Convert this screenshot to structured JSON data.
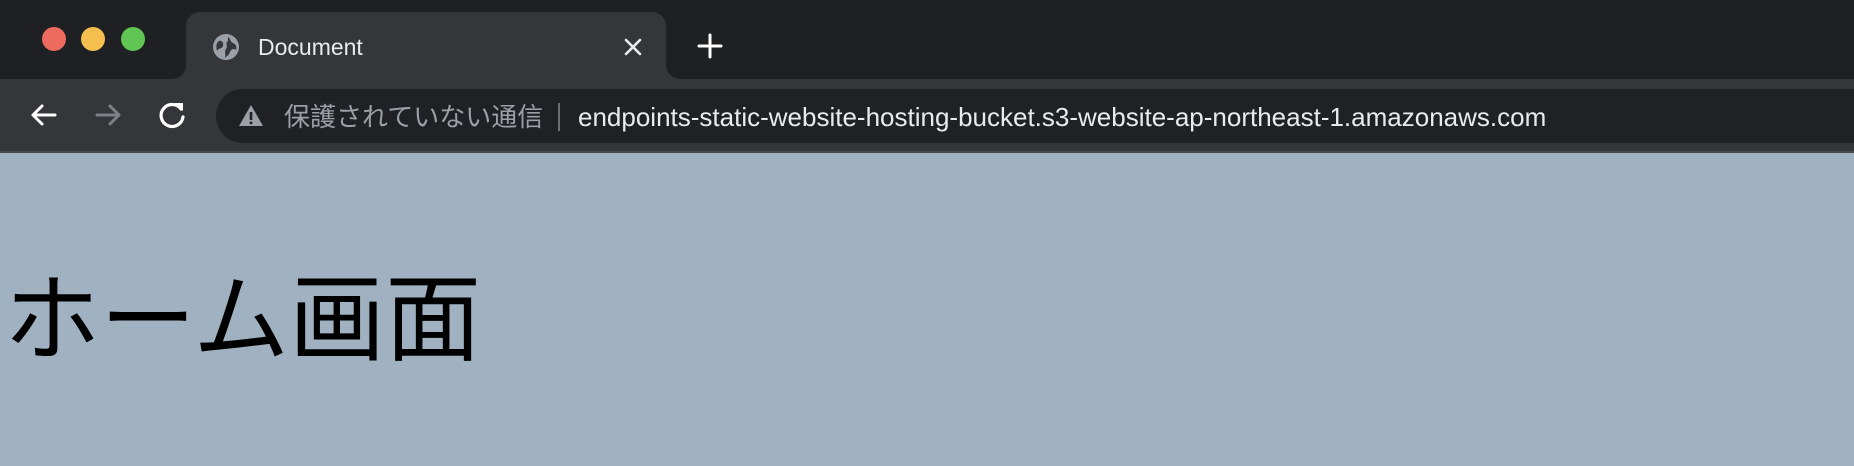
{
  "window": {
    "controls": [
      "close",
      "minimize",
      "maximize"
    ]
  },
  "tab": {
    "title": "Document",
    "favicon": "globe-icon",
    "close_icon": "close-icon"
  },
  "new_tab_icon": "plus-icon",
  "toolbar": {
    "back_icon": "arrow-left-icon",
    "forward_icon": "arrow-right-icon",
    "reload_icon": "reload-icon"
  },
  "omnibox": {
    "security_icon": "warning-icon",
    "security_label": "保護されていない通信",
    "url": "endpoints-static-website-hosting-bucket.s3-website-ap-northeast-1.amazonaws.com"
  },
  "page": {
    "heading": "ホーム画面",
    "background_color": "#a0b1c1"
  },
  "colors": {
    "tabstrip": "#1f2024",
    "toolbar": "#35363a",
    "omnibox": "#202124",
    "close": "#ed6a5e",
    "minimize": "#f5bf4f",
    "maximize": "#61c554"
  }
}
